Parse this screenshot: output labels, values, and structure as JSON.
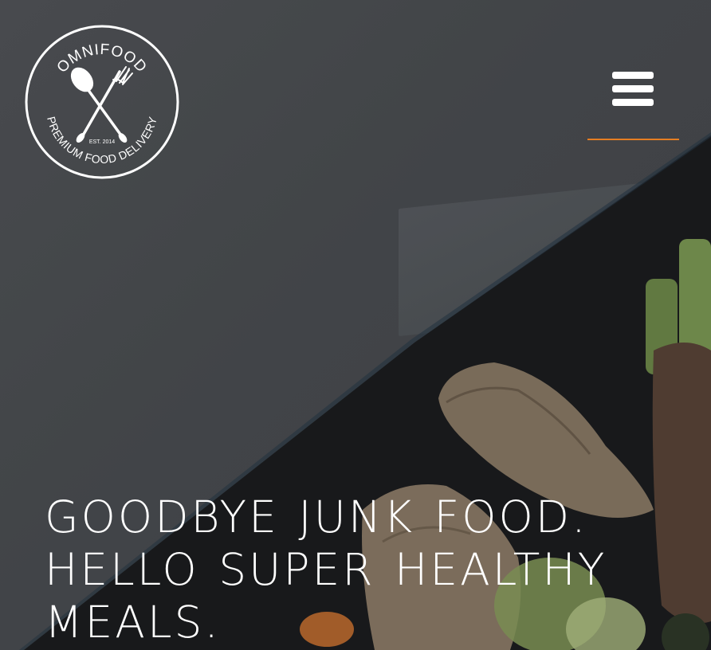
{
  "logo": {
    "brand": "OMNIFOOD",
    "tagline": "PREMIUM FOOD DELIVERY",
    "established": "EST. 2014"
  },
  "menu": {
    "icon": "hamburger-menu-icon"
  },
  "hero": {
    "headline_line1": "GOODBYE JUNK FOOD.",
    "headline_line2": "HELLO SUPER HEALTHY",
    "headline_line3": "MEALS."
  },
  "colors": {
    "accent": "#e67e22",
    "overlay": "#4a4d51",
    "text": "#ffffff"
  }
}
